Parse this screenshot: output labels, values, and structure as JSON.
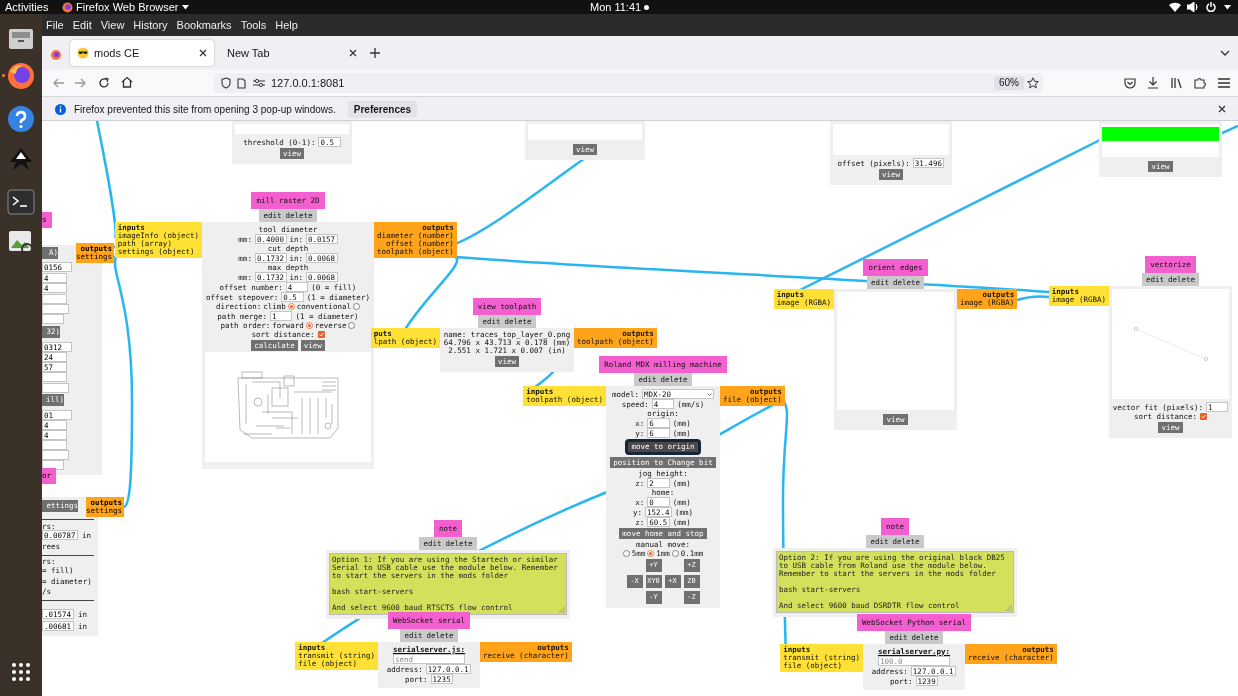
{
  "top_bar": {
    "activities": "Activities",
    "app_menu": "Firefox Web Browser",
    "clock": "Mon 11:41"
  },
  "menu_bar": [
    "File",
    "Edit",
    "View",
    "History",
    "Bookmarks",
    "Tools",
    "Help"
  ],
  "tabs": [
    {
      "label": "mods CE",
      "selected": true
    },
    {
      "label": "New Tab",
      "selected": false
    }
  ],
  "address_bar": {
    "url": "127.0.0.1:8081",
    "zoom": "60%"
  },
  "notification": {
    "message": "Firefox prevented this site from opening 3 pop-up windows.",
    "button": "Preferences"
  },
  "modules": [
    {
      "rows": [
        {
          "kind": "preview"
        },
        {
          "kind": "field",
          "label": "threshold (0-1):",
          "value": "0.5"
        },
        {
          "kind": "buttons",
          "buttons": [
            {
              "label": "view",
              "focused": false
            }
          ]
        }
      ]
    },
    {
      "rows": [
        {
          "kind": "preview"
        },
        {
          "kind": "buttons",
          "buttons": [
            {
              "label": "view",
              "focused": false
            }
          ]
        }
      ]
    },
    {
      "rows": [
        {
          "kind": "preview"
        },
        {
          "kind": "field",
          "label": "offset (pixels):",
          "value": "31.496"
        },
        {
          "kind": "buttons",
          "buttons": [
            {
              "label": "view",
              "focused": false
            }
          ]
        }
      ]
    },
    {
      "rows": [
        {
          "kind": "preview"
        },
        {
          "kind": "buttons",
          "buttons": [
            {
              "label": "view",
              "focused": false
            }
          ]
        }
      ]
    },
    {
      "title": "mill raster 2D",
      "actions": [
        "edit",
        "delete"
      ],
      "inputs": {
        "heading": "inputs",
        "ports": [
          "imageInfo (object)",
          "path (array)",
          "settings (object)"
        ]
      },
      "outputs": {
        "heading": "outputs",
        "ports": [
          "diameter (number)",
          "offset (number)",
          "toolpath (object)"
        ]
      },
      "rows": [
        {
          "kind": "heading",
          "text": "tool diameter"
        },
        {
          "kind": "pair",
          "label_1": "mm:",
          "value_1": "0.4000",
          "label_2": "in:",
          "value_2": "0.0157"
        },
        {
          "kind": "heading",
          "text": "cut depth"
        },
        {
          "kind": "pair",
          "label_1": "mm:",
          "value_1": "0.1732",
          "label_2": "in:",
          "value_2": "0.0068"
        },
        {
          "kind": "heading",
          "text": "max depth"
        },
        {
          "kind": "pair",
          "label_1": "mm:",
          "value_1": "0.1732",
          "label_2": "in:",
          "value_2": "0.0068"
        },
        {
          "kind": "field",
          "label": "offset number:",
          "value": "4",
          "unit": "(0 = fill)"
        },
        {
          "kind": "field",
          "label": "offset stepover:",
          "value": "0.5",
          "unit": "(1 = diameter)"
        },
        {
          "kind": "radio",
          "label": "direction:",
          "options": [
            {
              "label": "climb",
              "selected": true
            },
            {
              "label": "conventional",
              "selected": false
            }
          ]
        },
        {
          "kind": "field",
          "label": "path merge:",
          "value": "1",
          "unit": "(1 = diameter)"
        },
        {
          "kind": "radio",
          "label": "path order:",
          "options": [
            {
              "label": "forward",
              "selected": true
            },
            {
              "label": "reverse",
              "selected": false
            }
          ]
        },
        {
          "kind": "check",
          "label": "sort distance:",
          "checked": true
        },
        {
          "kind": "buttons",
          "buttons": [
            {
              "label": "calculate",
              "focused": false
            },
            {
              "label": "view",
              "focused": false
            }
          ]
        },
        {
          "kind": "preview"
        }
      ]
    },
    {
      "title": "view toolpath",
      "actions": [
        "edit",
        "delete"
      ],
      "inputs": {
        "heading": "puts",
        "ports": [
          "lpath (object)"
        ]
      },
      "outputs": {
        "heading": "outputs",
        "ports": [
          "toolpath (object)"
        ]
      },
      "rows": [
        {
          "kind": "lines",
          "lines": [
            "name: traces_top_layer_0.png",
            "64.796 x 43.713 x 0.178 (mm)",
            "2.551 x 1.721 x 0.007 (in)"
          ]
        },
        {
          "kind": "buttons",
          "buttons": [
            {
              "label": "view",
              "focused": false
            }
          ]
        }
      ]
    },
    {
      "title": "Roland MDX milling machine",
      "actions": [
        "edit",
        "delete"
      ],
      "inputs": {
        "heading": "inputs",
        "ports": [
          "toolpath (object)"
        ]
      },
      "outputs": {
        "heading": "outputs",
        "ports": [
          "file (object)"
        ]
      },
      "rows": [
        {
          "kind": "select",
          "label": "model:",
          "value": "MDX-20"
        },
        {
          "kind": "field",
          "label": "speed:",
          "value": "4",
          "unit": "(mm/s)"
        },
        {
          "kind": "heading",
          "text": "origin:"
        },
        {
          "kind": "field",
          "label": "x:",
          "value": "6",
          "unit": "(mm)"
        },
        {
          "kind": "field",
          "label": "y:",
          "value": "6",
          "unit": "(mm)"
        },
        {
          "kind": "buttons",
          "buttons": [
            {
              "label": "move to origin",
              "focused": true
            }
          ]
        },
        {
          "kind": "buttons",
          "buttons": [
            {
              "label": "position to Change bit",
              "focused": false
            }
          ]
        },
        {
          "kind": "heading",
          "text": "jog height:"
        },
        {
          "kind": "field",
          "label": "z:",
          "value": "2",
          "unit": "(mm)"
        },
        {
          "kind": "heading",
          "text": "home:"
        },
        {
          "kind": "field",
          "label": "x:",
          "value": "0",
          "unit": "(mm)"
        },
        {
          "kind": "field",
          "label": "y:",
          "value": "152.4",
          "unit": "(mm)"
        },
        {
          "kind": "field",
          "label": "z:",
          "value": "60.5",
          "unit": "(mm)"
        },
        {
          "kind": "buttons",
          "buttons": [
            {
              "label": "move home and stop",
              "focused": false
            }
          ]
        },
        {
          "kind": "heading",
          "text": "manual move:"
        },
        {
          "kind": "radio",
          "options": [
            {
              "label": "5mm",
              "selected": false
            },
            {
              "label": "1mm",
              "selected": true
            },
            {
              "label": "0.1mm",
              "selected": false
            }
          ]
        },
        {
          "kind": "jog",
          "buttons": [
            "+Y",
            "+Z",
            "-X",
            "XY0",
            "+X",
            "Z0",
            "-Y",
            "-Z"
          ]
        }
      ]
    },
    {
      "title": "orient edges",
      "actions": [
        "edit",
        "delete"
      ],
      "inputs": {
        "heading": "inputs",
        "ports": [
          "image (RGBA)"
        ]
      },
      "outputs": {
        "heading": "outputs",
        "ports": [
          "image (RGBA)"
        ]
      },
      "rows": [
        {
          "kind": "preview"
        },
        {
          "kind": "buttons",
          "buttons": [
            {
              "label": "view",
              "focused": false
            }
          ]
        }
      ]
    },
    {
      "title": "vectorize",
      "actions": [
        "edit",
        "delete"
      ],
      "inputs": {
        "heading": "inputs",
        "ports": [
          "image (RGBA)"
        ]
      },
      "rows": [
        {
          "kind": "preview"
        },
        {
          "kind": "field",
          "label": "vector fit (pixels):",
          "value": "1"
        },
        {
          "kind": "check",
          "label": "sort distance:",
          "checked": true
        },
        {
          "kind": "buttons",
          "buttons": [
            {
              "label": "view",
              "focused": false
            }
          ]
        }
      ]
    },
    {
      "title": "note",
      "actions": [
        "edit",
        "delete"
      ],
      "rows": [
        {
          "kind": "note",
          "text": "Option 1: If you are using the Startech or similar\nSerial to USB cable use the module below. Remember\nto start the servers in the mods folder\n\nbash start-servers\n\nAnd select 9600 baud RTSCTS flow control"
        }
      ]
    },
    {
      "title": "WebSocket serial",
      "actions": [
        "edit",
        "delete"
      ],
      "inputs": {
        "heading": "inputs",
        "ports": [
          "transmit (string)",
          "file (object)"
        ]
      },
      "outputs": {
        "heading": "outputs",
        "ports": [
          "receive (character)"
        ]
      },
      "rows": [
        {
          "kind": "link",
          "text": "serialserver.js:"
        },
        {
          "kind": "input",
          "placeholder": "send"
        },
        {
          "kind": "field",
          "label": "address:",
          "value": "127.0.0.1"
        },
        {
          "kind": "field",
          "label": "port:",
          "value": "1235"
        }
      ]
    },
    {
      "title": "note",
      "actions": [
        "edit",
        "delete"
      ],
      "rows": [
        {
          "kind": "note",
          "text": "Option 2: If you are using the original black DB25\nto USB cable from Roland use the module below.\nRemember to start the servers in the mods folder\n\nbash start-servers\n\nAnd select 9600 baud DSRDTR flow control"
        }
      ]
    },
    {
      "title": "WebSocket Python serial",
      "actions": [
        "edit",
        "delete"
      ],
      "inputs": {
        "heading": "inputs",
        "ports": [
          "transmit (string)",
          "file (object)"
        ]
      },
      "outputs": {
        "heading": "outputs",
        "ports": [
          "receive (character)"
        ]
      },
      "rows": [
        {
          "kind": "link",
          "text": "serialserver.py:"
        },
        {
          "kind": "input",
          "placeholder": "100.0"
        },
        {
          "kind": "field",
          "label": "address:",
          "value": "127.0.0.1"
        },
        {
          "kind": "field",
          "label": "port:",
          "value": "1239"
        }
      ]
    }
  ],
  "left_edge": [
    {
      "kind": "title",
      "text": "s"
    },
    {
      "kind": "button",
      "text": "A)"
    },
    {
      "kind": "outputs",
      "heading": "outputs",
      "port": "settings"
    },
    {
      "kind": "field",
      "text": "0156"
    },
    {
      "kind": "field",
      "text": "4"
    },
    {
      "kind": "field",
      "text": "4"
    },
    {
      "kind": "field"
    },
    {
      "kind": "field"
    },
    {
      "kind": "field"
    },
    {
      "kind": "button",
      "text": "32)"
    },
    {
      "kind": "field",
      "text": "0312"
    },
    {
      "kind": "field",
      "text": "24"
    },
    {
      "kind": "field",
      "text": "57"
    },
    {
      "kind": "field"
    },
    {
      "kind": "field"
    },
    {
      "kind": "button",
      "text": "ill)"
    },
    {
      "kind": "field",
      "text": "01"
    },
    {
      "kind": "field",
      "text": "4"
    },
    {
      "kind": "field",
      "text": "4"
    },
    {
      "kind": "field"
    },
    {
      "kind": "field"
    },
    {
      "kind": "field"
    },
    {
      "kind": "title",
      "text": "or"
    },
    {
      "kind": "button",
      "text": "ettings"
    },
    {
      "kind": "outputs",
      "heading": "outputs",
      "port": "settings"
    },
    {
      "kind": "text",
      "text": "rs:"
    },
    {
      "kind": "field",
      "text": "0.00787"
    },
    {
      "kind": "text",
      "text": "in"
    },
    {
      "kind": "text",
      "text": "rees"
    },
    {
      "kind": "text",
      "text": "rs:"
    },
    {
      "kind": "text",
      "text": "= fill)"
    },
    {
      "kind": "text",
      "text": "= diameter)"
    },
    {
      "kind": "text",
      "text": "/s"
    },
    {
      "kind": "field",
      "text": ".01574"
    },
    {
      "kind": "text",
      "text": "in"
    },
    {
      "kind": "field",
      "text": ".00681"
    },
    {
      "kind": "text",
      "text": "in"
    }
  ]
}
